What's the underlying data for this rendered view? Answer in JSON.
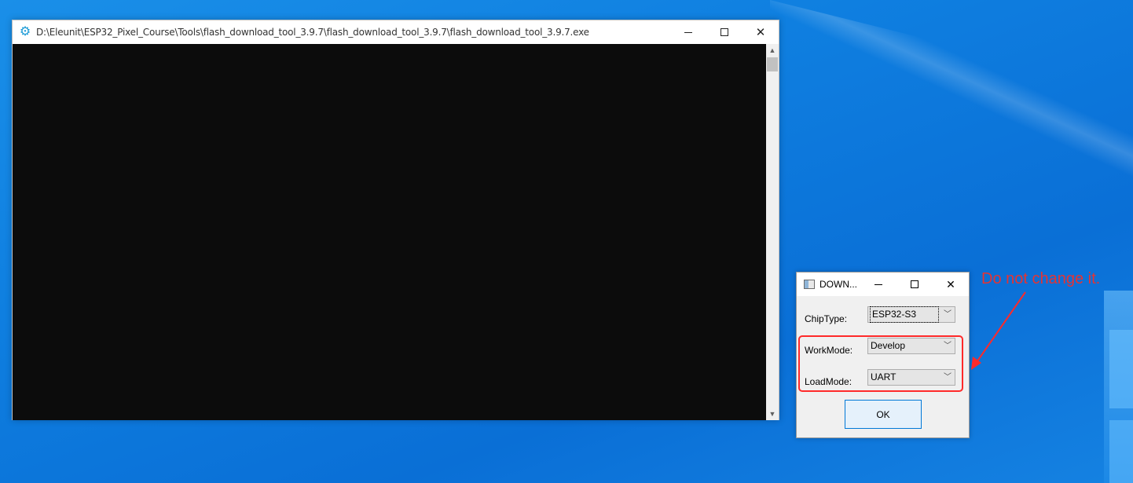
{
  "console": {
    "title": "D:\\Eleunit\\ESP32_Pixel_Course\\Tools\\flash_download_tool_3.9.7\\flash_download_tool_3.9.7\\flash_download_tool_3.9.7.exe"
  },
  "dialog": {
    "title": "DOWN...",
    "chip_type_label": "ChipType:",
    "chip_type_value": "ESP32-S3",
    "work_mode_label": "WorkMode:",
    "work_mode_value": "Develop",
    "load_mode_label": "LoadMode:",
    "load_mode_value": "UART",
    "ok_label": "OK"
  },
  "annotation": {
    "text": "Do not change it.",
    "color": "#e53333"
  },
  "colors": {
    "desktop": "#0f7fe0",
    "console_bg": "#0c0c0c",
    "ok_border": "#0078d7"
  }
}
